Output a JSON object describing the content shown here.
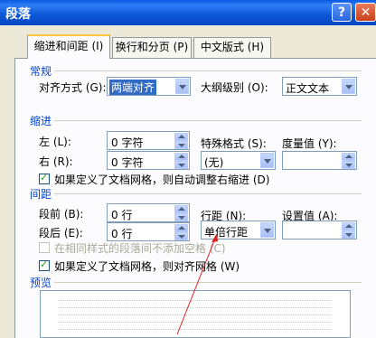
{
  "window": {
    "title": "段落",
    "help_glyph": "?",
    "close_glyph": "✕"
  },
  "tabs": [
    {
      "label": "缩进和间距 (I)"
    },
    {
      "label": "换行和分页 (P)"
    },
    {
      "label": "中文版式 (H)"
    }
  ],
  "general": {
    "section_label": "常规",
    "alignment_label": "对齐方式 (G):",
    "alignment_value": "两端对齐",
    "outline_label": "大纲级别 (O):",
    "outline_value": "正文文本"
  },
  "indent": {
    "section_label": "缩进",
    "left_label": "左 (L):",
    "left_value": "0 字符",
    "right_label": "右 (R):",
    "right_value": "0 字符",
    "special_label": "特殊格式 (S):",
    "special_value": "(无)",
    "by_label": "度量值 (Y):",
    "by_value": "",
    "auto_adjust_label": "如果定义了文档网格，则自动调整右缩进 (D)",
    "auto_adjust_checked": true
  },
  "spacing": {
    "section_label": "间距",
    "before_label": "段前 (B):",
    "before_value": "0 行",
    "after_label": "段后 (E):",
    "after_value": "0 行",
    "line_spacing_label": "行距 (N):",
    "line_spacing_value": "单倍行距",
    "at_label": "设置值 (A):",
    "at_value": "",
    "no_space_same_style_label": "在相同样式的段落间不添加空格 (C)",
    "no_space_same_style_checked": false,
    "snap_grid_label": "如果定义了文档网格，则对齐网格 (W)",
    "snap_grid_checked": true
  },
  "preview": {
    "section_label": "预览"
  },
  "colors": {
    "section": "#0046d5",
    "title_bar": "#0b56d6",
    "annotation_arrow": "#e02020"
  }
}
